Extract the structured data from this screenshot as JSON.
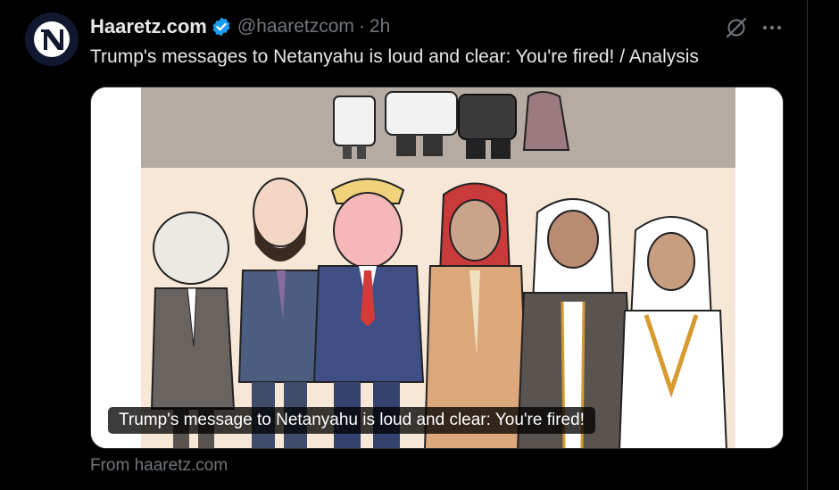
{
  "tweet": {
    "author": {
      "name": "Haaretz.com",
      "handle": "@haaretzcom",
      "verified": true,
      "avatar_icon": "haaretz-logo",
      "avatar_bg": "#11172f"
    },
    "separator": "·",
    "time": "2h",
    "text": "Trump's messages to Netanyahu is loud and clear: You're fired! / Analysis",
    "card": {
      "image_icon": "editorial-cartoon",
      "title": "Trump's message to Netanyahu is loud and clear: You're fired!",
      "source": "From haaretz.com"
    },
    "actions": {
      "grok_icon": "grok-icon",
      "more_icon": "more-icon"
    }
  },
  "colors": {
    "background": "#000000",
    "text_primary": "#e7e9ea",
    "text_secondary": "#71767b",
    "verified_blue": "#1d9bf0",
    "divider": "#2f3336"
  }
}
